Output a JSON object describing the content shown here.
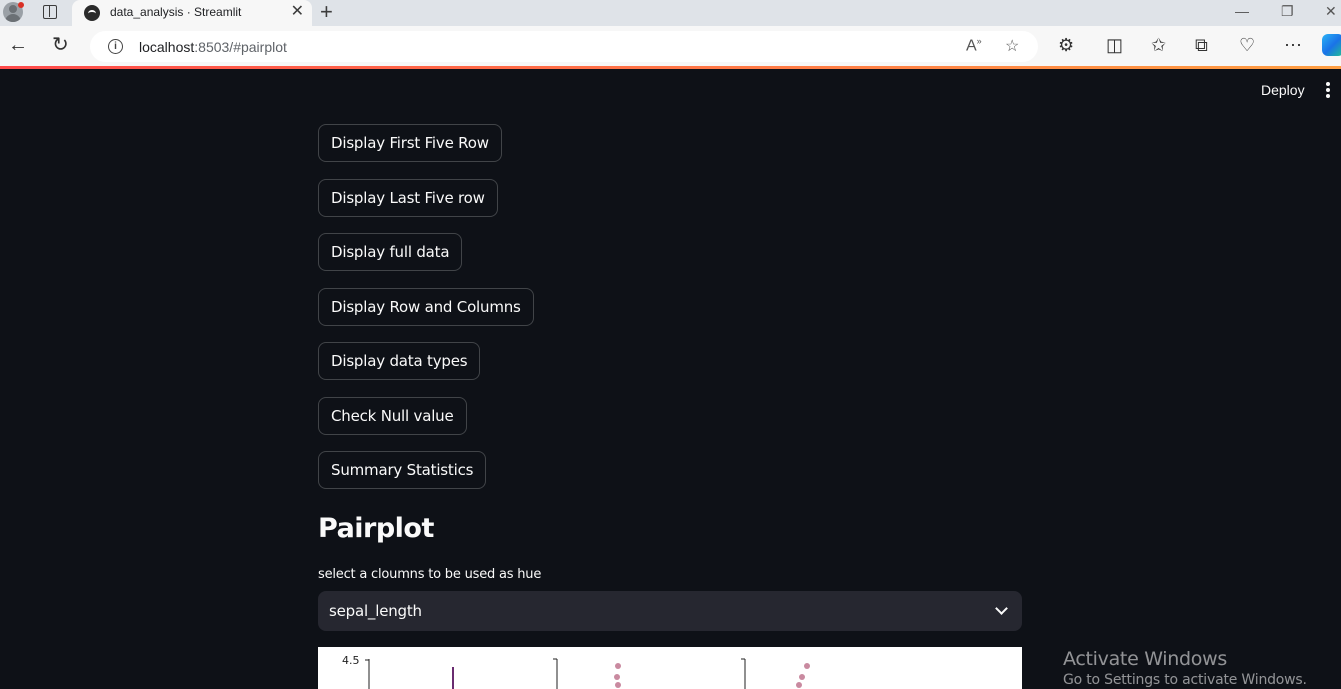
{
  "browser": {
    "tab_title": "data_analysis · Streamlit",
    "url_host": "localhost",
    "url_rest": ":8503/#pairplot",
    "icons": [
      "profile-icon",
      "tab-actions-icon",
      "streamlit-favicon",
      "close-icon",
      "new-tab-icon",
      "back-icon",
      "refresh-icon",
      "info-icon",
      "read-aloud-icon",
      "favorite-star-icon",
      "extensions-icon",
      "split-screen-icon",
      "favorites-icon",
      "collections-icon",
      "browser-essentials-icon",
      "more-icon",
      "copilot-icon"
    ]
  },
  "header": {
    "deploy_label": "Deploy"
  },
  "buttons": [
    {
      "label": "Display First Five Row"
    },
    {
      "label": "Display Last Five row"
    },
    {
      "label": "Display full data"
    },
    {
      "label": "Display Row and Columns"
    },
    {
      "label": "Display data types"
    },
    {
      "label": "Check Null value"
    },
    {
      "label": "Summary Statistics"
    }
  ],
  "pairplot": {
    "title": "Pairplot",
    "select_label": "select a cloumns to be used as hue",
    "selected_value": "sepal_length",
    "visible_tick_label": "4.5"
  },
  "watermark": {
    "title": "Activate Windows",
    "subtitle": "Go to Settings to activate Windows."
  },
  "colors": {
    "app_background": "#0e1117",
    "select_background": "#262730",
    "text": "#fafafa",
    "accent": "#ff4b4b"
  }
}
